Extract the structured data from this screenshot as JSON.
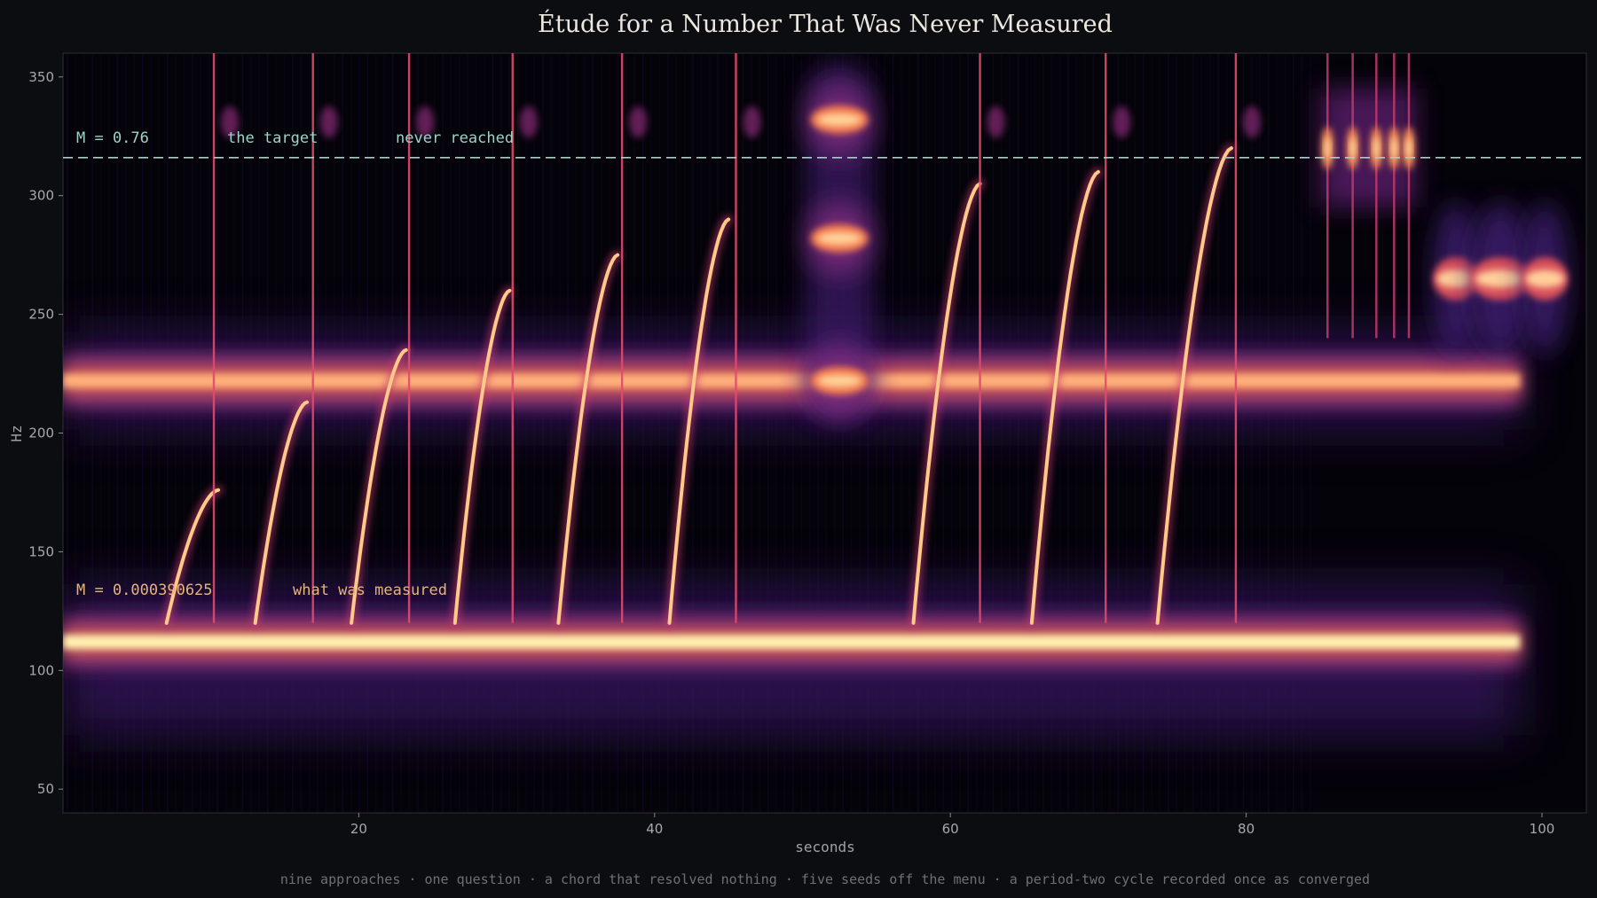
{
  "chart_data": {
    "type": "heatmap",
    "title": "Étude for a Number That Was Never Measured",
    "xlabel": "seconds",
    "ylabel": "Hz",
    "footer": "nine approaches · one question · a chord that resolved nothing · five seeds off the menu · a period-two cycle recorded once as converged",
    "xlim": [
      0,
      103
    ],
    "ylim": [
      40,
      360
    ],
    "x_ticks": [
      20,
      40,
      60,
      80,
      100
    ],
    "y_ticks": [
      50,
      100,
      150,
      200,
      250,
      300,
      350
    ],
    "colormap": "magma",
    "target_line": {
      "y": 316,
      "style": "dashed",
      "color": "#9ed3c8"
    },
    "annotations": {
      "target": {
        "value": "M = 0.76",
        "label": "the target",
        "note": "never reached",
        "color": "#9ed3c8"
      },
      "measured": {
        "value": "M = 0.000390625",
        "label": "what was measured",
        "color": "#e6b57a"
      }
    },
    "drone_bands": [
      {
        "name": "upper drone",
        "freq_hz": 222,
        "x_start": 0,
        "x_end": 98.5
      },
      {
        "name": "lower drone",
        "freq_hz": 112,
        "x_start": 0,
        "x_end": 98.5
      }
    ],
    "approaches": [
      {
        "start_x": 7.0,
        "end_x": 10.5,
        "f_start": 120,
        "f_end": 176,
        "rebound_x": 10.2
      },
      {
        "start_x": 13.0,
        "end_x": 16.5,
        "f_start": 120,
        "f_end": 213,
        "rebound_x": 16.9
      },
      {
        "start_x": 19.5,
        "end_x": 23.2,
        "f_start": 120,
        "f_end": 235,
        "rebound_x": 23.4
      },
      {
        "start_x": 26.5,
        "end_x": 30.2,
        "f_start": 120,
        "f_end": 260,
        "rebound_x": 30.4
      },
      {
        "start_x": 33.5,
        "end_x": 37.5,
        "f_start": 120,
        "f_end": 275,
        "rebound_x": 37.8
      },
      {
        "start_x": 41.0,
        "end_x": 45.0,
        "f_start": 120,
        "f_end": 290,
        "rebound_x": 45.5
      },
      {
        "start_x": 57.5,
        "end_x": 62.0,
        "f_start": 120,
        "f_end": 305,
        "rebound_x": 62.0
      },
      {
        "start_x": 65.5,
        "end_x": 70.0,
        "f_start": 120,
        "f_end": 310,
        "rebound_x": 70.5
      },
      {
        "start_x": 74.0,
        "end_x": 79.0,
        "f_start": 120,
        "f_end": 320,
        "rebound_x": 79.3
      }
    ],
    "chord": {
      "x_center": 52.5,
      "freqs_hz": [
        332,
        282,
        222
      ],
      "x_width": 4.5
    },
    "seeds": {
      "x_values": [
        85.5,
        87.2,
        88.8,
        90.0,
        91.0
      ],
      "freq_hz": 320
    },
    "period_two_cycle": {
      "x_values": [
        94.2,
        97.2,
        100.2
      ],
      "freq_hz": 265
    }
  }
}
